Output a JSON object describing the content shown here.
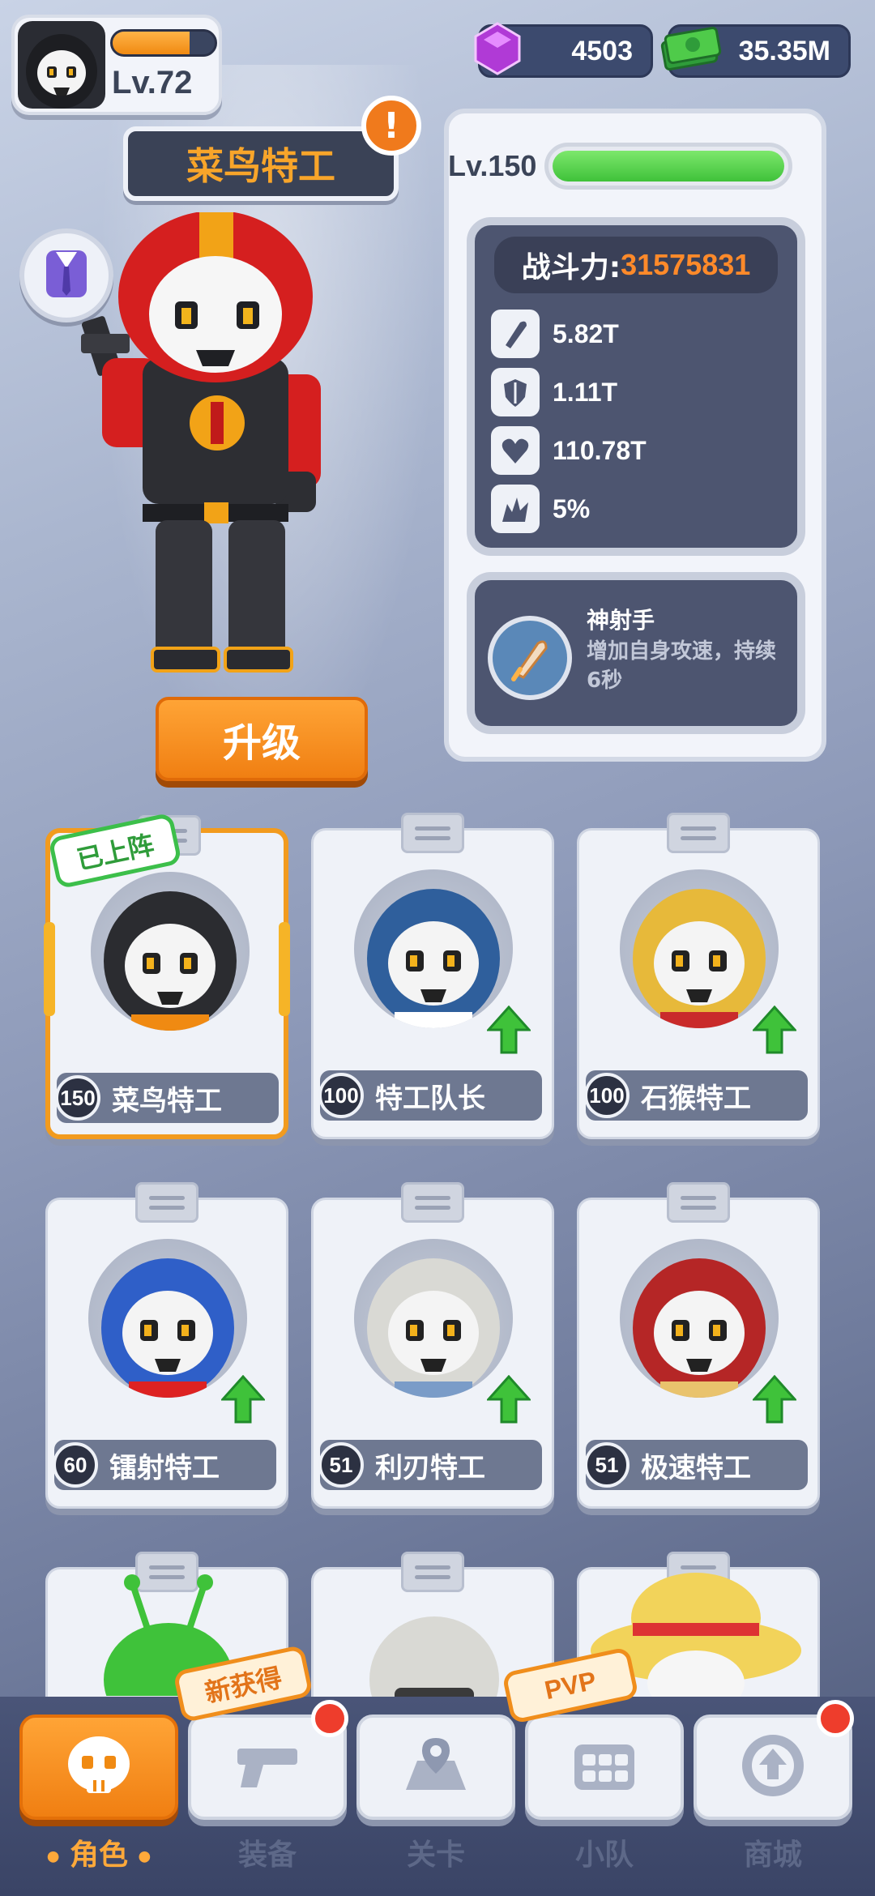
{
  "player": {
    "level": "Lv.72",
    "xp_fraction": 0.75
  },
  "currency": {
    "gems": "4503",
    "cash": "35.35M"
  },
  "agent": {
    "name": "菜鸟特工",
    "alert": "!",
    "upgrade_label": "升级",
    "level_label": "Lv.150",
    "level_fraction": 1.0,
    "power_label": "战斗力:",
    "power_value": "31575831",
    "stats": [
      {
        "icon": "bullet-icon",
        "value": "5.82T"
      },
      {
        "icon": "shield-icon",
        "value": "1.11T"
      },
      {
        "icon": "heart-icon",
        "value": "110.78T"
      },
      {
        "icon": "critical-icon",
        "value": "5%"
      }
    ],
    "skill": {
      "name": "神射手",
      "description": "增加自身攻速，持续6秒"
    }
  },
  "roster": [
    {
      "level": "150",
      "name": "菜鸟特工",
      "deployed": true,
      "deployed_label": "已上阵",
      "upgradable": false,
      "hood": "#2b2c30",
      "accent": "#f08a12"
    },
    {
      "level": "100",
      "name": "特工队长",
      "deployed": false,
      "upgradable": true,
      "hood": "#2f5f9c",
      "accent": "#ffffff"
    },
    {
      "level": "100",
      "name": "石猴特工",
      "deployed": false,
      "upgradable": true,
      "hood": "#e7b93a",
      "accent": "#c92b2b"
    },
    {
      "level": "60",
      "name": "镭射特工",
      "deployed": false,
      "upgradable": true,
      "hood": "#2f5fc8",
      "accent": "#d22"
    },
    {
      "level": "51",
      "name": "利刃特工",
      "deployed": false,
      "upgradable": true,
      "hood": "#d9d9d4",
      "accent": "#7a9cc8"
    },
    {
      "level": "51",
      "name": "极速特工",
      "deployed": false,
      "upgradable": true,
      "hood": "#b52626",
      "accent": "#e9c36d"
    }
  ],
  "nav": {
    "items": [
      {
        "label": "角色",
        "icon": "skull-icon",
        "active": true
      },
      {
        "label": "装备",
        "icon": "gun-icon",
        "active": false,
        "badge": true,
        "tag": "新获得"
      },
      {
        "label": "关卡",
        "icon": "map-pin-icon",
        "active": false
      },
      {
        "label": "小队",
        "icon": "team-icon",
        "active": false,
        "tag": "PVP"
      },
      {
        "label": "商城",
        "icon": "shop-icon",
        "active": false,
        "badge": true
      }
    ]
  },
  "colors": {
    "accent_orange": "#f08a12",
    "green": "#3fc23a",
    "panel_dark": "#4d5570"
  }
}
